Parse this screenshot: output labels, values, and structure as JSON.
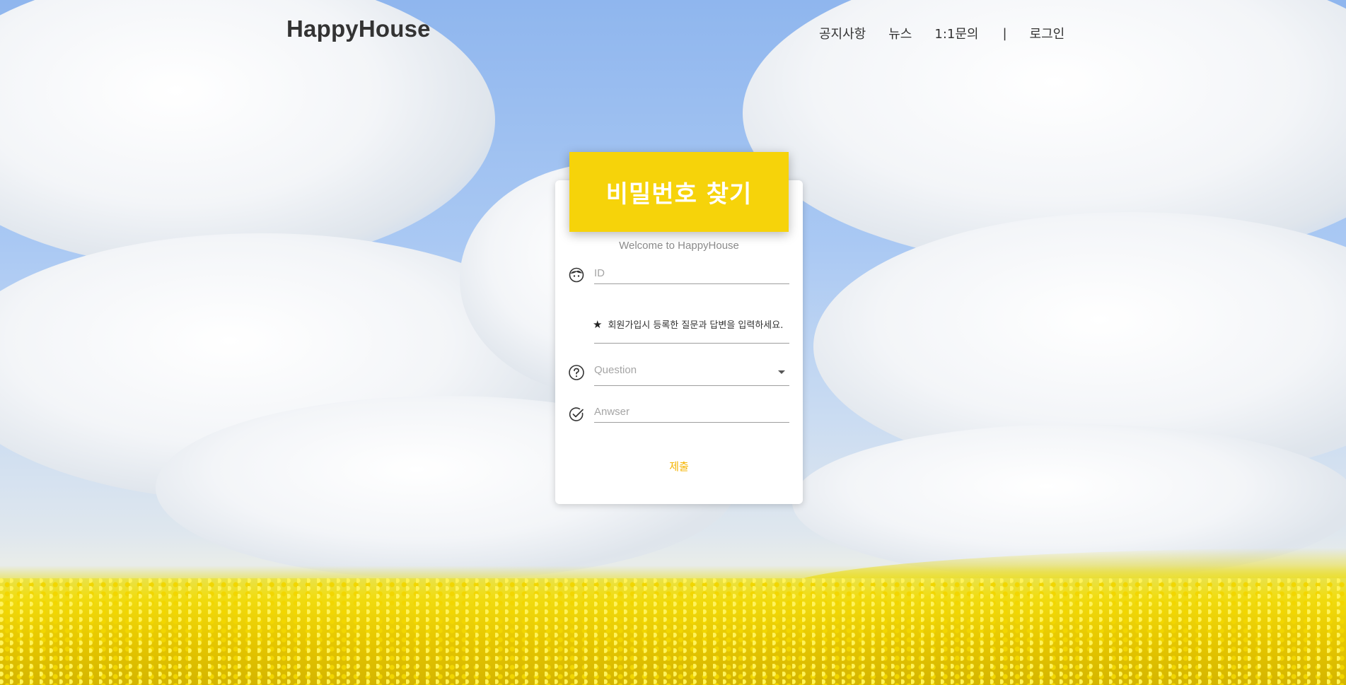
{
  "header": {
    "brand": "HappyHouse",
    "nav": {
      "notice": "공지사항",
      "news": "뉴스",
      "qna": "1:1문의",
      "separator": "|",
      "login": "로그인"
    }
  },
  "form": {
    "title": "비밀번호 찾기",
    "welcome": "Welcome to HappyHouse",
    "id_placeholder": "ID",
    "notice_text": "회원가입시 등록한 질문과 답변을 입력하세요.",
    "question_value": "Question",
    "answer_placeholder": "Anwser",
    "submit_label": "제출"
  },
  "icons": {
    "id": "face-icon",
    "notice": "star-icon",
    "question": "question-circle-icon",
    "answer": "check-circle-icon"
  },
  "colors": {
    "accent": "#f6d30a",
    "submit": "#f5b400"
  }
}
